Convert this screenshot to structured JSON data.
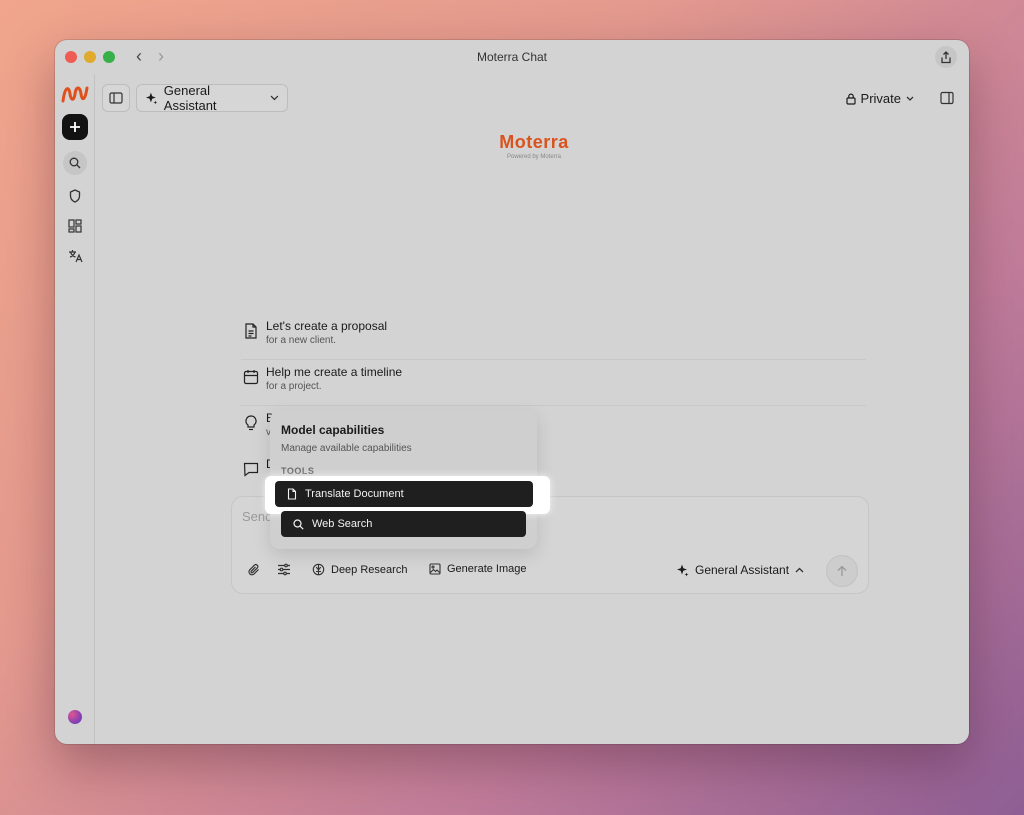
{
  "window": {
    "title": "Moterra Chat"
  },
  "topbar": {
    "assistant_label": "General Assistant",
    "privacy_label": "Private"
  },
  "brand": {
    "name": "Moterra",
    "tagline": "Powered by Moterra"
  },
  "suggestions": [
    {
      "title": "Let's create a proposal",
      "subtitle": "for a new client.",
      "icon": "document-icon"
    },
    {
      "title": "Help me create a timeline",
      "subtitle": "for a project.",
      "icon": "calendar-icon"
    },
    {
      "title": "B",
      "subtitle": "v",
      "icon": "lightbulb-icon"
    },
    {
      "title": "D",
      "subtitle": "",
      "icon": "chat-bubble-icon"
    }
  ],
  "composer": {
    "placeholder": "Send",
    "tools": {
      "deep_research": "Deep Research",
      "generate_image": "Generate Image"
    },
    "assistant_label": "General Assistant"
  },
  "capabilities_popup": {
    "title": "Model capabilities",
    "subtitle": "Manage available capabilities",
    "section_label": "TOOLS",
    "items": [
      {
        "label": "Translate Document",
        "icon": "file-icon",
        "highlighted": true
      },
      {
        "label": "Web Search",
        "icon": "search-icon",
        "highlighted": false
      }
    ]
  },
  "colors": {
    "brand_orange": "#d9531e",
    "menu_item_bg": "#1f1f1f"
  }
}
